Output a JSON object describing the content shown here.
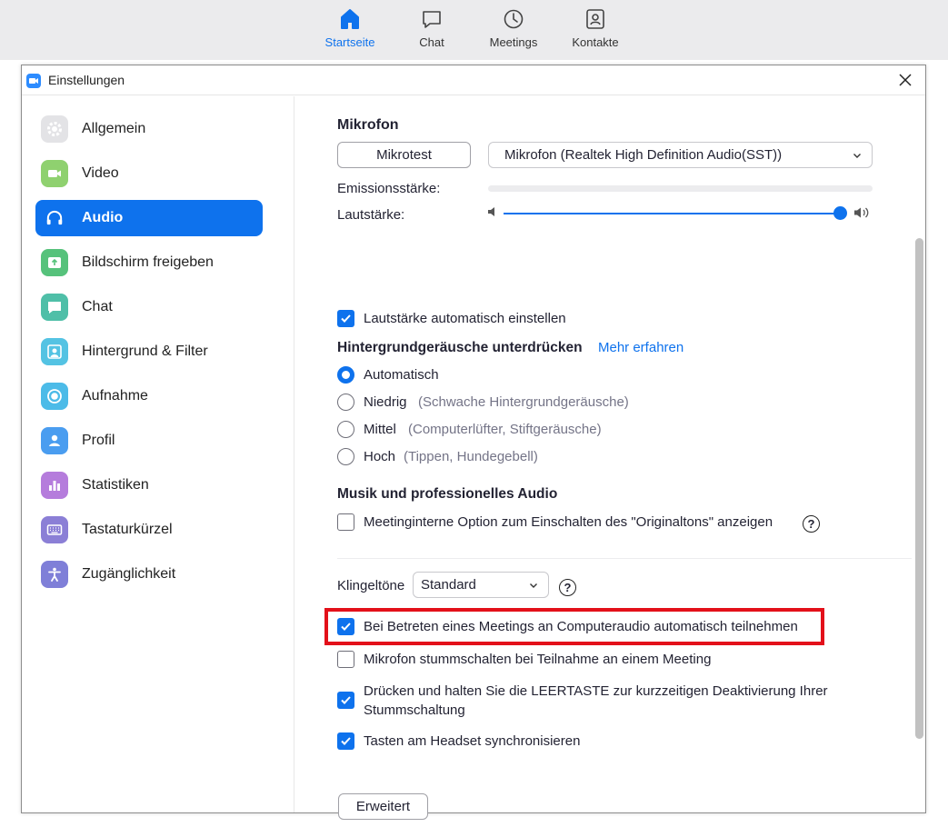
{
  "top_nav": [
    {
      "label": "Startseite",
      "icon": "home-icon",
      "active": true
    },
    {
      "label": "Chat",
      "icon": "chat-icon",
      "active": false
    },
    {
      "label": "Meetings",
      "icon": "clock-icon",
      "active": false
    },
    {
      "label": "Kontakte",
      "icon": "contacts-icon",
      "active": false
    }
  ],
  "window": {
    "title": "Einstellungen"
  },
  "sidebar": {
    "items": [
      {
        "label": "Allgemein",
        "icon": "gear-icon",
        "color": "#e3e3e6"
      },
      {
        "label": "Video",
        "icon": "video-icon",
        "color": "#8fd16f"
      },
      {
        "label": "Audio",
        "icon": "headphones-icon",
        "color": "#0e72ed",
        "active": true
      },
      {
        "label": "Bildschirm freigeben",
        "icon": "share-screen-icon",
        "color": "#56c27b"
      },
      {
        "label": "Chat",
        "icon": "chat-icon",
        "color": "#4fbfa8"
      },
      {
        "label": "Hintergrund & Filter",
        "icon": "background-icon",
        "color": "#54c3e3"
      },
      {
        "label": "Aufnahme",
        "icon": "record-icon",
        "color": "#4cbbe8"
      },
      {
        "label": "Profil",
        "icon": "profile-icon",
        "color": "#4a9df0"
      },
      {
        "label": "Statistiken",
        "icon": "statistics-icon",
        "color": "#b57cdc"
      },
      {
        "label": "Tastaturkürzel",
        "icon": "keyboard-icon",
        "color": "#8b7fd6"
      },
      {
        "label": "Zugänglichkeit",
        "icon": "accessibility-icon",
        "color": "#7f7fd8"
      }
    ]
  },
  "audio": {
    "mic_heading": "Mikrofon",
    "mic_test_button": "Mikrotest",
    "mic_select_value": "Mikrofon (Realtek High Definition Audio(SST))",
    "emission_label": "Emissionsstärke:",
    "volume_label": "Lautstärke:",
    "volume_level": 1.0,
    "auto_volume": {
      "label": "Lautstärke automatisch einstellen",
      "checked": true
    },
    "noise_heading": "Hintergrundgeräusche unterdrücken",
    "noise_link": "Mehr erfahren",
    "noise_options": [
      {
        "label": "Automatisch",
        "hint": "",
        "selected": true
      },
      {
        "label": "Niedrig",
        "hint": "(Schwache Hintergrundgeräusche)",
        "selected": false
      },
      {
        "label": "Mittel",
        "hint": "(Computerlüfter, Stiftgeräusche)",
        "selected": false
      },
      {
        "label": "Hoch",
        "hint": "(Tippen, Hundegebell)",
        "selected": false
      }
    ],
    "music_heading": "Musik und professionelles Audio",
    "original_sound": {
      "label": "Meetinginterne Option zum Einschalten des \"Originaltons\" anzeigen",
      "checked": false
    },
    "ringtone_label": "Klingeltöne",
    "ringtone_value": "Standard",
    "help_glyph": "?",
    "options": [
      {
        "label": "Bei Betreten eines Meetings an Computeraudio automatisch teilnehmen",
        "checked": true,
        "highlighted": true
      },
      {
        "label": "Mikrofon stummschalten bei Teilnahme an einem Meeting",
        "checked": false
      },
      {
        "line1": "Drücken und halten Sie die LEERTASTE zur kurzzeitigen Deaktivierung Ihrer",
        "line2": "Stummschaltung",
        "checked": true
      },
      {
        "label": "Tasten am Headset synchronisieren",
        "checked": true
      }
    ],
    "advanced_button": "Erweitert"
  },
  "colors": {
    "accent": "#0e72ed",
    "highlight": "#e3101a"
  }
}
